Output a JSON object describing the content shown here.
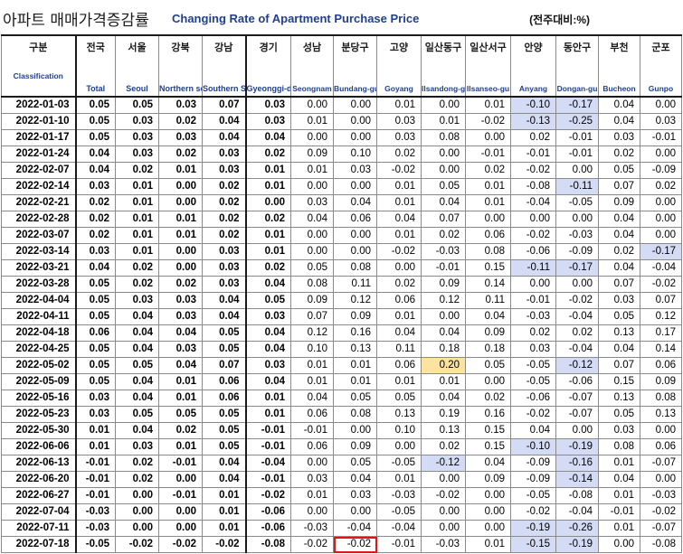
{
  "title": {
    "korean": "아파트 매매가격증감률",
    "english": "Changing Rate of Apartment Purchase Price",
    "unit": "(전주대비:%)"
  },
  "columns": [
    {
      "ko": "구분",
      "en": "Classification"
    },
    {
      "ko": "전국",
      "en": "Total"
    },
    {
      "ko": "서울",
      "en": "Seoul"
    },
    {
      "ko": "강북",
      "en": "Northern seoul"
    },
    {
      "ko": "강남",
      "en": "Southern Seoul"
    },
    {
      "ko": "경기",
      "en": "Gyeonggi-do"
    },
    {
      "ko": "성남",
      "en": "Seongnam"
    },
    {
      "ko": "분당구",
      "en": "Bundang-gu"
    },
    {
      "ko": "고양",
      "en": "Goyang"
    },
    {
      "ko": "일산동구",
      "en": "Ilsandong-gu"
    },
    {
      "ko": "일산서구",
      "en": "Ilsanseo-gu"
    },
    {
      "ko": "안양",
      "en": "Anyang"
    },
    {
      "ko": "동안구",
      "en": "Dongan-gu"
    },
    {
      "ko": "부천",
      "en": "Bucheon"
    },
    {
      "ko": "군포",
      "en": "Gunpo"
    }
  ],
  "rows": [
    {
      "date": "2022-01-03",
      "values": [
        "0.05",
        "0.05",
        "0.03",
        "0.07",
        "0.03",
        "0.00",
        "0.00",
        "0.01",
        "0.00",
        "0.01",
        "-0.10",
        "-0.17",
        "0.04",
        "0.00"
      ]
    },
    {
      "date": "2022-01-10",
      "values": [
        "0.05",
        "0.03",
        "0.02",
        "0.04",
        "0.03",
        "0.01",
        "0.00",
        "0.03",
        "0.01",
        "-0.02",
        "-0.13",
        "-0.25",
        "0.04",
        "0.03"
      ]
    },
    {
      "date": "2022-01-17",
      "values": [
        "0.05",
        "0.03",
        "0.03",
        "0.04",
        "0.04",
        "0.00",
        "0.00",
        "0.03",
        "0.08",
        "0.00",
        "0.02",
        "-0.01",
        "0.03",
        "-0.01"
      ]
    },
    {
      "date": "2022-01-24",
      "values": [
        "0.04",
        "0.03",
        "0.02",
        "0.03",
        "0.02",
        "0.09",
        "0.10",
        "0.02",
        "0.00",
        "-0.01",
        "-0.01",
        "-0.01",
        "0.02",
        "0.00"
      ]
    },
    {
      "date": "2022-02-07",
      "values": [
        "0.04",
        "0.02",
        "0.01",
        "0.03",
        "0.01",
        "0.01",
        "0.03",
        "-0.02",
        "0.00",
        "0.02",
        "-0.02",
        "0.00",
        "0.05",
        "-0.09"
      ]
    },
    {
      "date": "2022-02-14",
      "values": [
        "0.03",
        "0.01",
        "0.00",
        "0.02",
        "0.01",
        "0.00",
        "0.00",
        "0.01",
        "0.05",
        "0.01",
        "-0.08",
        "-0.11",
        "0.07",
        "0.02"
      ]
    },
    {
      "date": "2022-02-21",
      "values": [
        "0.02",
        "0.01",
        "0.00",
        "0.02",
        "0.00",
        "0.03",
        "0.04",
        "0.01",
        "0.04",
        "0.01",
        "-0.04",
        "-0.05",
        "0.09",
        "0.00"
      ]
    },
    {
      "date": "2022-02-28",
      "values": [
        "0.02",
        "0.01",
        "0.01",
        "0.02",
        "0.02",
        "0.04",
        "0.06",
        "0.04",
        "0.07",
        "0.00",
        "0.00",
        "0.00",
        "0.04",
        "0.00"
      ]
    },
    {
      "date": "2022-03-07",
      "values": [
        "0.02",
        "0.01",
        "0.01",
        "0.02",
        "0.01",
        "0.00",
        "0.00",
        "0.01",
        "0.02",
        "0.06",
        "-0.02",
        "-0.03",
        "0.04",
        "0.00"
      ]
    },
    {
      "date": "2022-03-14",
      "values": [
        "0.03",
        "0.01",
        "0.00",
        "0.03",
        "0.01",
        "0.00",
        "0.00",
        "-0.02",
        "-0.03",
        "0.08",
        "-0.06",
        "-0.09",
        "0.02",
        "-0.17"
      ]
    },
    {
      "date": "2022-03-21",
      "values": [
        "0.04",
        "0.02",
        "0.00",
        "0.03",
        "0.02",
        "0.05",
        "0.08",
        "0.00",
        "-0.01",
        "0.15",
        "-0.11",
        "-0.17",
        "0.04",
        "-0.04"
      ]
    },
    {
      "date": "2022-03-28",
      "values": [
        "0.05",
        "0.02",
        "0.02",
        "0.03",
        "0.04",
        "0.08",
        "0.11",
        "0.02",
        "0.09",
        "0.14",
        "0.00",
        "0.00",
        "0.07",
        "-0.02"
      ]
    },
    {
      "date": "2022-04-04",
      "values": [
        "0.05",
        "0.03",
        "0.03",
        "0.04",
        "0.05",
        "0.09",
        "0.12",
        "0.06",
        "0.12",
        "0.11",
        "-0.01",
        "-0.02",
        "0.03",
        "0.07"
      ]
    },
    {
      "date": "2022-04-11",
      "values": [
        "0.05",
        "0.04",
        "0.03",
        "0.04",
        "0.03",
        "0.07",
        "0.09",
        "0.01",
        "0.00",
        "0.04",
        "-0.03",
        "-0.04",
        "0.05",
        "0.12"
      ]
    },
    {
      "date": "2022-04-18",
      "values": [
        "0.06",
        "0.04",
        "0.04",
        "0.05",
        "0.04",
        "0.12",
        "0.16",
        "0.04",
        "0.04",
        "0.09",
        "0.02",
        "0.02",
        "0.13",
        "0.17"
      ]
    },
    {
      "date": "2022-04-25",
      "values": [
        "0.05",
        "0.04",
        "0.03",
        "0.05",
        "0.04",
        "0.10",
        "0.13",
        "0.11",
        "0.18",
        "0.18",
        "0.03",
        "-0.04",
        "0.04",
        "0.14"
      ]
    },
    {
      "date": "2022-05-02",
      "values": [
        "0.05",
        "0.05",
        "0.04",
        "0.07",
        "0.03",
        "0.01",
        "0.01",
        "0.06",
        "0.20",
        "0.05",
        "-0.05",
        "-0.12",
        "0.07",
        "0.06"
      ]
    },
    {
      "date": "2022-05-09",
      "values": [
        "0.05",
        "0.04",
        "0.01",
        "0.06",
        "0.04",
        "0.01",
        "0.01",
        "0.01",
        "0.01",
        "0.00",
        "-0.05",
        "-0.06",
        "0.15",
        "0.09"
      ]
    },
    {
      "date": "2022-05-16",
      "values": [
        "0.03",
        "0.04",
        "0.01",
        "0.06",
        "0.01",
        "0.04",
        "0.05",
        "0.05",
        "0.04",
        "0.02",
        "-0.06",
        "-0.07",
        "0.13",
        "0.08"
      ]
    },
    {
      "date": "2022-05-23",
      "values": [
        "0.03",
        "0.05",
        "0.05",
        "0.05",
        "0.01",
        "0.06",
        "0.08",
        "0.13",
        "0.19",
        "0.16",
        "-0.02",
        "-0.07",
        "0.05",
        "0.13"
      ]
    },
    {
      "date": "2022-05-30",
      "values": [
        "0.01",
        "0.04",
        "0.02",
        "0.05",
        "-0.01",
        "-0.01",
        "0.00",
        "0.10",
        "0.13",
        "0.15",
        "0.04",
        "0.00",
        "0.03",
        "0.00"
      ]
    },
    {
      "date": "2022-06-06",
      "values": [
        "0.01",
        "0.03",
        "0.01",
        "0.05",
        "-0.01",
        "0.06",
        "0.09",
        "0.00",
        "0.02",
        "0.15",
        "-0.10",
        "-0.19",
        "0.08",
        "0.06"
      ]
    },
    {
      "date": "2022-06-13",
      "values": [
        "-0.01",
        "0.02",
        "-0.01",
        "0.04",
        "-0.04",
        "0.00",
        "0.05",
        "-0.05",
        "-0.12",
        "0.04",
        "-0.09",
        "-0.16",
        "0.01",
        "-0.07"
      ]
    },
    {
      "date": "2022-06-20",
      "values": [
        "-0.01",
        "0.02",
        "0.00",
        "0.04",
        "-0.01",
        "0.03",
        "0.04",
        "0.01",
        "0.00",
        "0.09",
        "-0.09",
        "-0.14",
        "0.04",
        "0.00"
      ]
    },
    {
      "date": "2022-06-27",
      "values": [
        "-0.01",
        "0.00",
        "-0.01",
        "0.01",
        "-0.02",
        "0.01",
        "0.03",
        "-0.03",
        "-0.02",
        "0.00",
        "-0.05",
        "-0.08",
        "0.01",
        "-0.03"
      ]
    },
    {
      "date": "2022-07-04",
      "values": [
        "-0.03",
        "0.00",
        "0.00",
        "0.01",
        "-0.06",
        "0.00",
        "0.00",
        "-0.05",
        "0.00",
        "0.00",
        "-0.02",
        "-0.04",
        "-0.01",
        "-0.02"
      ]
    },
    {
      "date": "2022-07-11",
      "values": [
        "-0.03",
        "0.00",
        "0.00",
        "0.01",
        "-0.06",
        "-0.03",
        "-0.04",
        "-0.04",
        "0.00",
        "0.00",
        "-0.19",
        "-0.26",
        "0.01",
        "-0.07"
      ]
    },
    {
      "date": "2022-07-18",
      "values": [
        "-0.05",
        "-0.02",
        "-0.02",
        "-0.02",
        "-0.08",
        "-0.02",
        "-0.02",
        "-0.01",
        "-0.03",
        "0.01",
        "-0.15",
        "-0.19",
        "0.00",
        "-0.08"
      ]
    }
  ],
  "highlight_colors": {
    "blue": "#d4dcf5",
    "yellow": "#fde3a0",
    "red_outline": "#e0151a"
  }
}
